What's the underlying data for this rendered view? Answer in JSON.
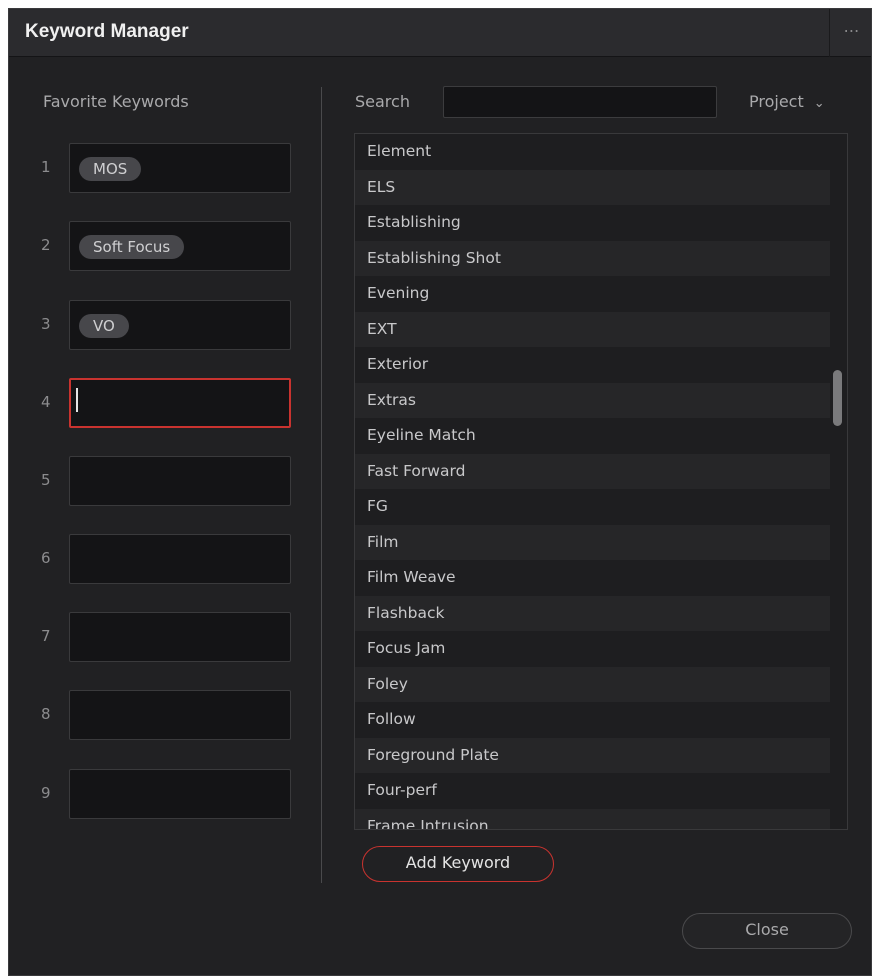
{
  "window": {
    "title": "Keyword Manager",
    "more_icon": "⋯"
  },
  "favorites": {
    "header": "Favorite Keywords",
    "slots": [
      {
        "number": "1",
        "keyword": "MOS"
      },
      {
        "number": "2",
        "keyword": "Soft Focus"
      },
      {
        "number": "3",
        "keyword": "VO"
      },
      {
        "number": "4",
        "keyword": ""
      },
      {
        "number": "5",
        "keyword": ""
      },
      {
        "number": "6",
        "keyword": ""
      },
      {
        "number": "7",
        "keyword": ""
      },
      {
        "number": "8",
        "keyword": ""
      },
      {
        "number": "9",
        "keyword": ""
      }
    ]
  },
  "search": {
    "label": "Search",
    "value": "",
    "scope": "Project",
    "scope_icon": "chevron-down-icon"
  },
  "keywords": [
    "Element",
    "ELS",
    "Establishing",
    "Establishing Shot",
    "Evening",
    "EXT",
    "Exterior",
    "Extras",
    "Eyeline Match",
    "Fast Forward",
    "FG",
    "Film",
    "Film Weave",
    "Flashback",
    "Focus Jam",
    "Foley",
    "Follow",
    "Foreground Plate",
    "Four-perf",
    "Frame Intrusion"
  ],
  "buttons": {
    "add_keyword": "Add Keyword",
    "close": "Close"
  },
  "colors": {
    "accent": "#c9332f",
    "background": "#212123"
  }
}
